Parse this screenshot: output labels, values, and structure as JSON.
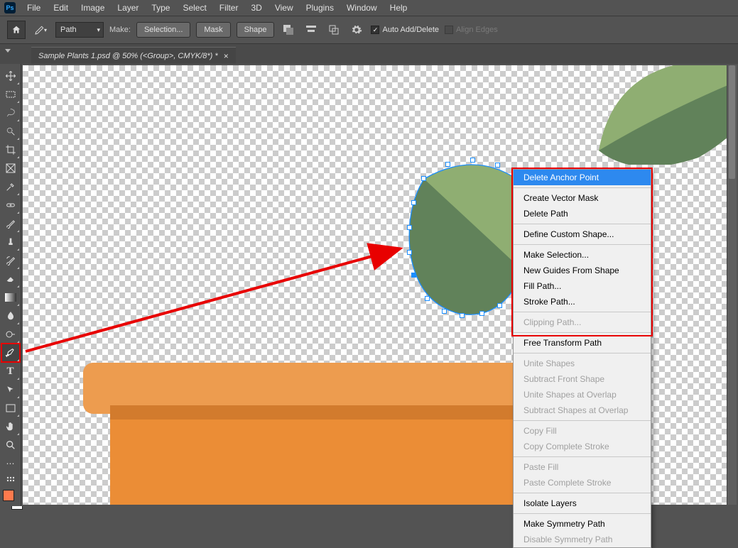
{
  "app": {
    "logo": "Ps"
  },
  "menu": [
    "File",
    "Edit",
    "Image",
    "Layer",
    "Type",
    "Select",
    "Filter",
    "3D",
    "View",
    "Plugins",
    "Window",
    "Help"
  ],
  "options": {
    "dropdown_value": "Path",
    "make_label": "Make:",
    "btn_selection": "Selection...",
    "btn_mask": "Mask",
    "btn_shape": "Shape",
    "auto_add": "Auto Add/Delete",
    "align_edges": "Align Edges"
  },
  "tab": {
    "title": "Sample Plants 1.psd @ 50% (<Group>, CMYK/8*) *"
  },
  "tools": [
    {
      "name": "move",
      "glyph": "✥"
    },
    {
      "name": "marquee",
      "glyph": "▭"
    },
    {
      "name": "lasso",
      "glyph": "◉"
    },
    {
      "name": "quick-select",
      "glyph": "✦"
    },
    {
      "name": "crop",
      "glyph": "✂"
    },
    {
      "name": "frame",
      "glyph": "▣"
    },
    {
      "name": "eyedropper",
      "glyph": "✎"
    },
    {
      "name": "healing",
      "glyph": "✚"
    },
    {
      "name": "brush",
      "glyph": "✏"
    },
    {
      "name": "stamp",
      "glyph": "⎍"
    },
    {
      "name": "history-brush",
      "glyph": "↺"
    },
    {
      "name": "eraser",
      "glyph": "▰"
    },
    {
      "name": "gradient",
      "glyph": "▤"
    },
    {
      "name": "blur",
      "glyph": "△"
    },
    {
      "name": "dodge",
      "glyph": "○"
    },
    {
      "name": "pen",
      "glyph": "✒"
    },
    {
      "name": "type",
      "glyph": "T"
    },
    {
      "name": "path-select",
      "glyph": "↖"
    },
    {
      "name": "rectangle",
      "glyph": "□"
    },
    {
      "name": "hand",
      "glyph": "✋"
    },
    {
      "name": "zoom",
      "glyph": "🔍"
    },
    {
      "name": "more",
      "glyph": "⋯"
    },
    {
      "name": "edit-toolbar",
      "glyph": "⋮"
    }
  ],
  "context_menu": {
    "groups": [
      [
        {
          "label": "Delete Anchor Point",
          "hi": true
        }
      ],
      [
        {
          "label": "Create Vector Mask"
        },
        {
          "label": "Delete Path"
        }
      ],
      [
        {
          "label": "Define Custom Shape..."
        }
      ],
      [
        {
          "label": "Make Selection..."
        },
        {
          "label": "New Guides From Shape"
        },
        {
          "label": "Fill Path..."
        },
        {
          "label": "Stroke Path..."
        }
      ],
      [
        {
          "label": "Clipping Path...",
          "dis": true
        }
      ],
      [
        {
          "label": "Free Transform Path"
        }
      ],
      [
        {
          "label": "Unite Shapes",
          "dis": true
        },
        {
          "label": "Subtract Front Shape",
          "dis": true
        },
        {
          "label": "Unite Shapes at Overlap",
          "dis": true
        },
        {
          "label": "Subtract Shapes at Overlap",
          "dis": true
        }
      ],
      [
        {
          "label": "Copy Fill",
          "dis": true
        },
        {
          "label": "Copy Complete Stroke",
          "dis": true
        }
      ],
      [
        {
          "label": "Paste Fill",
          "dis": true
        },
        {
          "label": "Paste Complete Stroke",
          "dis": true
        }
      ],
      [
        {
          "label": "Isolate Layers"
        }
      ],
      [
        {
          "label": "Make Symmetry Path"
        },
        {
          "label": "Disable Symmetry Path",
          "dis": true
        }
      ]
    ]
  },
  "colors": {
    "accent": "#1b8eff",
    "highlight_red": "#e80000",
    "pot_rim": "#ed9c4f",
    "pot_body": "#eb8d36",
    "leaf_light": "#8fae72",
    "leaf_dark": "#61825a"
  }
}
